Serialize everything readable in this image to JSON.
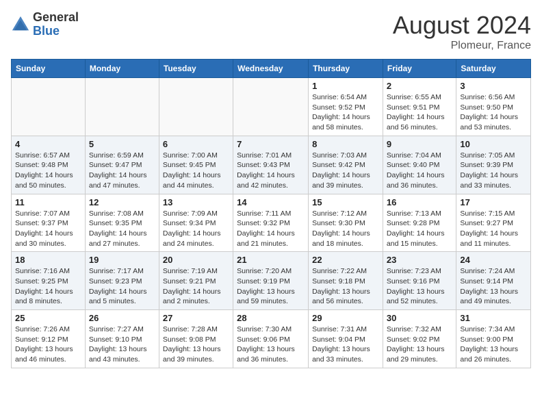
{
  "header": {
    "logo_general": "General",
    "logo_blue": "Blue",
    "title": "August 2024",
    "subtitle": "Plomeur, France"
  },
  "weekdays": [
    "Sunday",
    "Monday",
    "Tuesday",
    "Wednesday",
    "Thursday",
    "Friday",
    "Saturday"
  ],
  "weeks": [
    [
      {
        "day": "",
        "info": ""
      },
      {
        "day": "",
        "info": ""
      },
      {
        "day": "",
        "info": ""
      },
      {
        "day": "",
        "info": ""
      },
      {
        "day": "1",
        "info": "Sunrise: 6:54 AM\nSunset: 9:52 PM\nDaylight: 14 hours\nand 58 minutes."
      },
      {
        "day": "2",
        "info": "Sunrise: 6:55 AM\nSunset: 9:51 PM\nDaylight: 14 hours\nand 56 minutes."
      },
      {
        "day": "3",
        "info": "Sunrise: 6:56 AM\nSunset: 9:50 PM\nDaylight: 14 hours\nand 53 minutes."
      }
    ],
    [
      {
        "day": "4",
        "info": "Sunrise: 6:57 AM\nSunset: 9:48 PM\nDaylight: 14 hours\nand 50 minutes."
      },
      {
        "day": "5",
        "info": "Sunrise: 6:59 AM\nSunset: 9:47 PM\nDaylight: 14 hours\nand 47 minutes."
      },
      {
        "day": "6",
        "info": "Sunrise: 7:00 AM\nSunset: 9:45 PM\nDaylight: 14 hours\nand 44 minutes."
      },
      {
        "day": "7",
        "info": "Sunrise: 7:01 AM\nSunset: 9:43 PM\nDaylight: 14 hours\nand 42 minutes."
      },
      {
        "day": "8",
        "info": "Sunrise: 7:03 AM\nSunset: 9:42 PM\nDaylight: 14 hours\nand 39 minutes."
      },
      {
        "day": "9",
        "info": "Sunrise: 7:04 AM\nSunset: 9:40 PM\nDaylight: 14 hours\nand 36 minutes."
      },
      {
        "day": "10",
        "info": "Sunrise: 7:05 AM\nSunset: 9:39 PM\nDaylight: 14 hours\nand 33 minutes."
      }
    ],
    [
      {
        "day": "11",
        "info": "Sunrise: 7:07 AM\nSunset: 9:37 PM\nDaylight: 14 hours\nand 30 minutes."
      },
      {
        "day": "12",
        "info": "Sunrise: 7:08 AM\nSunset: 9:35 PM\nDaylight: 14 hours\nand 27 minutes."
      },
      {
        "day": "13",
        "info": "Sunrise: 7:09 AM\nSunset: 9:34 PM\nDaylight: 14 hours\nand 24 minutes."
      },
      {
        "day": "14",
        "info": "Sunrise: 7:11 AM\nSunset: 9:32 PM\nDaylight: 14 hours\nand 21 minutes."
      },
      {
        "day": "15",
        "info": "Sunrise: 7:12 AM\nSunset: 9:30 PM\nDaylight: 14 hours\nand 18 minutes."
      },
      {
        "day": "16",
        "info": "Sunrise: 7:13 AM\nSunset: 9:28 PM\nDaylight: 14 hours\nand 15 minutes."
      },
      {
        "day": "17",
        "info": "Sunrise: 7:15 AM\nSunset: 9:27 PM\nDaylight: 14 hours\nand 11 minutes."
      }
    ],
    [
      {
        "day": "18",
        "info": "Sunrise: 7:16 AM\nSunset: 9:25 PM\nDaylight: 14 hours\nand 8 minutes."
      },
      {
        "day": "19",
        "info": "Sunrise: 7:17 AM\nSunset: 9:23 PM\nDaylight: 14 hours\nand 5 minutes."
      },
      {
        "day": "20",
        "info": "Sunrise: 7:19 AM\nSunset: 9:21 PM\nDaylight: 14 hours\nand 2 minutes."
      },
      {
        "day": "21",
        "info": "Sunrise: 7:20 AM\nSunset: 9:19 PM\nDaylight: 13 hours\nand 59 minutes."
      },
      {
        "day": "22",
        "info": "Sunrise: 7:22 AM\nSunset: 9:18 PM\nDaylight: 13 hours\nand 56 minutes."
      },
      {
        "day": "23",
        "info": "Sunrise: 7:23 AM\nSunset: 9:16 PM\nDaylight: 13 hours\nand 52 minutes."
      },
      {
        "day": "24",
        "info": "Sunrise: 7:24 AM\nSunset: 9:14 PM\nDaylight: 13 hours\nand 49 minutes."
      }
    ],
    [
      {
        "day": "25",
        "info": "Sunrise: 7:26 AM\nSunset: 9:12 PM\nDaylight: 13 hours\nand 46 minutes."
      },
      {
        "day": "26",
        "info": "Sunrise: 7:27 AM\nSunset: 9:10 PM\nDaylight: 13 hours\nand 43 minutes."
      },
      {
        "day": "27",
        "info": "Sunrise: 7:28 AM\nSunset: 9:08 PM\nDaylight: 13 hours\nand 39 minutes."
      },
      {
        "day": "28",
        "info": "Sunrise: 7:30 AM\nSunset: 9:06 PM\nDaylight: 13 hours\nand 36 minutes."
      },
      {
        "day": "29",
        "info": "Sunrise: 7:31 AM\nSunset: 9:04 PM\nDaylight: 13 hours\nand 33 minutes."
      },
      {
        "day": "30",
        "info": "Sunrise: 7:32 AM\nSunset: 9:02 PM\nDaylight: 13 hours\nand 29 minutes."
      },
      {
        "day": "31",
        "info": "Sunrise: 7:34 AM\nSunset: 9:00 PM\nDaylight: 13 hours\nand 26 minutes."
      }
    ]
  ]
}
